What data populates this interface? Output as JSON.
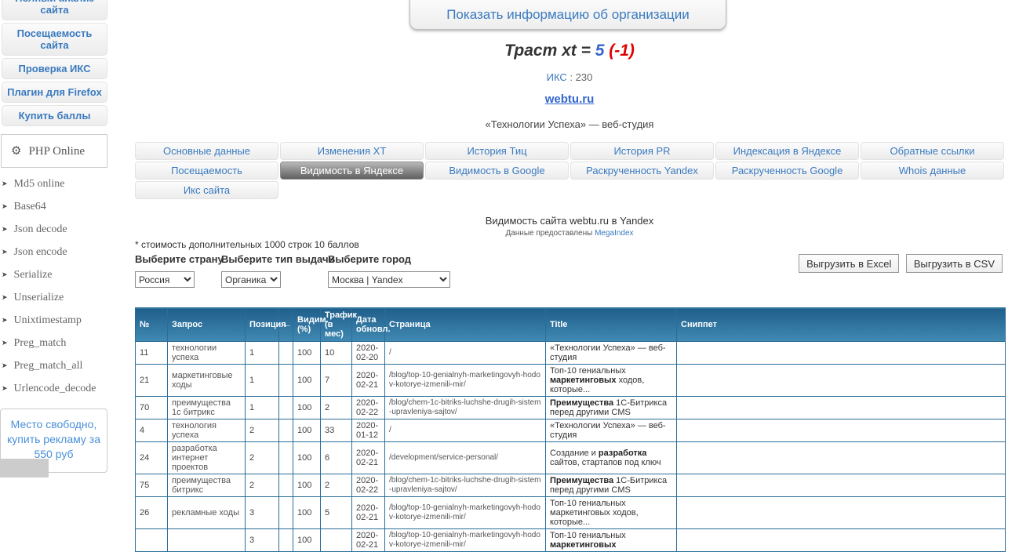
{
  "sidebar": {
    "buttons": [
      "Полный анализ сайта",
      "Посещаемость сайта",
      "Проверка ИКС",
      "Плагин для Firefox",
      "Купить баллы"
    ],
    "php_widget": {
      "title": "PHP  Online",
      "items": [
        "Md5  online",
        "Base64",
        "Json  decode",
        "Json  encode",
        "Serialize",
        "Unserialize",
        "Unixtimestamp",
        "Preg_match",
        "Preg_match_all",
        "Urlencode_decode"
      ]
    },
    "ad_box": "Место свободно, купить рекламу за 550 руб"
  },
  "header": {
    "org_button": "Показать информацию об организации",
    "trust": {
      "prefix": "Траст xt = ",
      "value": "5",
      "delta": " (-1)"
    },
    "iks": {
      "label": "ИКС",
      "value": " : 230"
    },
    "domain": "webtu.ru",
    "site_title": "«Технологии Успеха» — веб-студия"
  },
  "tabs": [
    {
      "label": "Основные данные",
      "row": 1,
      "active": false,
      "name": "osnovnye-dannye"
    },
    {
      "label": "Изменения XT",
      "row": 1,
      "active": false,
      "name": "izmeneniya-xt"
    },
    {
      "label": "История Тиц",
      "row": 1,
      "active": false,
      "name": "istoriya-tic"
    },
    {
      "label": "История PR",
      "row": 1,
      "active": false,
      "name": "istoriya-pr"
    },
    {
      "label": "Индексация в Яндексе",
      "row": 1,
      "active": false,
      "name": "indeksaciya-v-yandekse"
    },
    {
      "label": "Обратные ссылки",
      "row": 1,
      "active": false,
      "name": "obratnye-ssylki"
    },
    {
      "label": "Посещаемость",
      "row": 2,
      "active": false,
      "name": "poseshchaemost"
    },
    {
      "label": "Видимость в Яндексе",
      "row": 2,
      "active": true,
      "name": "vidimost-v-yandekse"
    },
    {
      "label": "Видимость в Google",
      "row": 2,
      "active": false,
      "name": "vidimost-v-google"
    },
    {
      "label": "Раскрученность Yandex",
      "row": 2,
      "active": false,
      "name": "raskruchennost-yandex"
    },
    {
      "label": "Раскрученность Google",
      "row": 2,
      "active": false,
      "name": "raskruchennost-google"
    },
    {
      "label": "Whois данные",
      "row": 2,
      "active": false,
      "name": "whois-dannye"
    },
    {
      "label": "Икс сайта",
      "row": 3,
      "active": false,
      "name": "iks-sajta"
    }
  ],
  "visibility": {
    "title": "Видимость сайта webtu.ru в Yandex",
    "source_prefix": "Данные предоставлены ",
    "source_link": "MegaIndex",
    "cost_note": "* стоимость дополнительных 1000 строк 10 баллов",
    "filters": [
      {
        "label": "Выберите страну",
        "value": "Россия"
      },
      {
        "label": "Выберите тип выдачи",
        "value": "Органика"
      },
      {
        "label": "Выберите город",
        "value": "Москва | Yandex"
      }
    ],
    "export_buttons": [
      "Выгрузить в Excel",
      "Выгрузить в CSV"
    ],
    "table": {
      "headers": [
        "№",
        "Запрос",
        "Позиция",
        "←",
        "Видим. (%)",
        "Трафик (в мес)",
        "Дата обновл.",
        "Страница",
        "Title",
        "Сниппет"
      ],
      "rows": [
        {
          "num": "11",
          "query": "технологии успеха",
          "position": "1",
          "arrow": "",
          "visibility": "100",
          "traffic": "10",
          "updated": "2020-02-20",
          "page": "/",
          "title_pre": "«Технологии Успеха» — веб-студия",
          "title_bold": "",
          "title_post": "",
          "snippet": ""
        },
        {
          "num": "21",
          "query": "маркетинговые ходы",
          "position": "1",
          "arrow": "",
          "visibility": "100",
          "traffic": "7",
          "updated": "2020-02-21",
          "page": "/blog/top-10-genialnyh-marketingovyh-hodov-kotorye-izmenili-mir/",
          "title_pre": "Топ-10 гениальных ",
          "title_bold": "маркетинговых",
          "title_post": " ходов, которые...",
          "snippet": ""
        },
        {
          "num": "70",
          "query": "преимущества 1с битрикс",
          "position": "1",
          "arrow": "",
          "visibility": "100",
          "traffic": "2",
          "updated": "2020-02-22",
          "page": "/blog/chem-1c-bitriks-luchshe-drugih-sistem-upravleniya-sajtov/",
          "title_pre": "",
          "title_bold": "Преимущества",
          "title_post": " 1С-Битрикса перед другими CMS",
          "snippet": ""
        },
        {
          "num": "4",
          "query": "технология успеха",
          "position": "2",
          "arrow": "",
          "visibility": "100",
          "traffic": "33",
          "updated": "2020-01-12",
          "page": "/",
          "title_pre": "«Технологии Успеха» — веб-студия",
          "title_bold": "",
          "title_post": "",
          "snippet": ""
        },
        {
          "num": "24",
          "query": "разработка интернет проектов",
          "position": "2",
          "arrow": "",
          "visibility": "100",
          "traffic": "6",
          "updated": "2020-02-21",
          "page": "/development/service-personal/",
          "title_pre": "Создание и ",
          "title_bold": "разработка",
          "title_post": " сайтов, стартапов под ключ",
          "snippet": ""
        },
        {
          "num": "75",
          "query": "преимущества битрикс",
          "position": "2",
          "arrow": "",
          "visibility": "100",
          "traffic": "2",
          "updated": "2020-02-22",
          "page": "/blog/chem-1c-bitriks-luchshe-drugih-sistem-upravleniya-sajtov/",
          "title_pre": "",
          "title_bold": "Преимущества",
          "title_post": " 1С-Битрикса перед другими CMS",
          "snippet": ""
        },
        {
          "num": "26",
          "query": "рекламные ходы",
          "position": "3",
          "arrow": "",
          "visibility": "100",
          "traffic": "5",
          "updated": "2020-02-21",
          "page": "/blog/top-10-genialnyh-marketingovyh-hodov-kotorye-izmenili-mir/",
          "title_pre": "Топ-10 гениальных маркетинговых ходов, которые...",
          "title_bold": "",
          "title_post": "",
          "snippet": ""
        },
        {
          "num": "",
          "query": "",
          "position": "3",
          "arrow": "",
          "visibility": "100",
          "traffic": "",
          "updated": "2020-02-21",
          "page": "/blog/top-10-genialnyh-marketingovyh-hodov-kotorye-izmenili-mir/",
          "title_pre": "Топ-10 гениальных ",
          "title_bold": "маркетинговых",
          "title_post": "",
          "snippet": ""
        }
      ]
    }
  }
}
